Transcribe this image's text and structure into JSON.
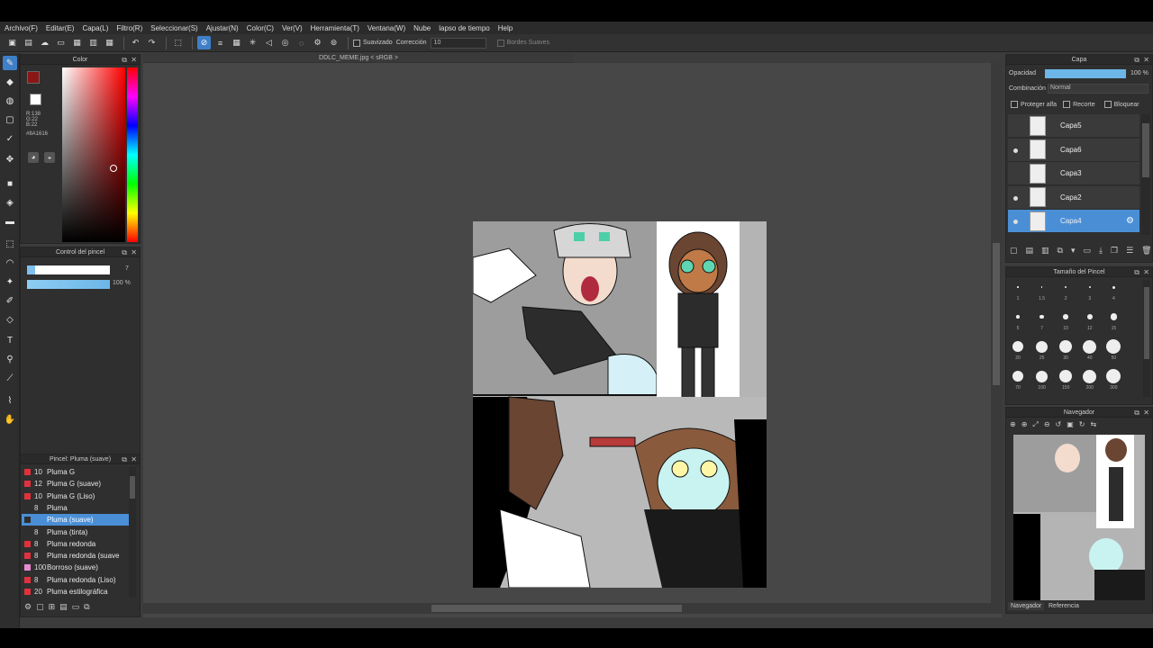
{
  "menu": [
    "Archivo(F)",
    "Editar(E)",
    "Capa(L)",
    "Filtro(R)",
    "Seleccionar(S)",
    "Ajustar(N)",
    "Color(C)",
    "Ver(V)",
    "Herramienta(T)",
    "Ventana(W)",
    "Nube",
    "lapso de tiempo",
    "Help"
  ],
  "toolbar": {
    "smooth_label": "Suavizado",
    "correction_label": "Corrección",
    "correction_value": "10",
    "soft_edges_label": "Bordes Suaves"
  },
  "color_panel": {
    "title": "Color",
    "current_color": "#8A1616",
    "r": "R:138",
    "g": "G:22",
    "b": "B:22",
    "hex": "#8A1616"
  },
  "brush_control": {
    "title": "Control del pincel",
    "size": "7",
    "opacity": "100 %"
  },
  "brush_panel": {
    "title": "Pincel: Pluma (suave)",
    "items": [
      {
        "num": "10",
        "name": "Pluma G",
        "color": "#e0323c"
      },
      {
        "num": "12",
        "name": "Pluma G (suave)",
        "color": "#e0323c"
      },
      {
        "num": "10",
        "name": "Pluma G (Liso)",
        "color": "#e0323c"
      },
      {
        "num": "8",
        "name": "Pluma",
        "color": "#2e2e2e"
      },
      {
        "num": "",
        "name": "Pluma (suave)",
        "color": "#2e2e2e",
        "selected": true
      },
      {
        "num": "8",
        "name": "Pluma (tinta)",
        "color": "#2e2e2e"
      },
      {
        "num": "8",
        "name": "Pluma redonda",
        "color": "#e0323c"
      },
      {
        "num": "8",
        "name": "Pluma redonda (suave",
        "color": "#e0323c"
      },
      {
        "num": "100",
        "name": "Borroso (suave)",
        "color": "#e98ad2"
      },
      {
        "num": "8",
        "name": "Pluma redonda (Liso)",
        "color": "#e0323c"
      },
      {
        "num": "20",
        "name": "Pluma estilográfica",
        "color": "#e0323c"
      }
    ]
  },
  "document": {
    "tab": "DDLC_MEME.jpg < sRGB >"
  },
  "layer_panel": {
    "title": "Capa",
    "opacity_label": "Opacidad",
    "opacity_value": "100 %",
    "opacity_fraction": 1.0,
    "blend_label": "Combinación",
    "blend_value": "Normal",
    "protect_alpha": "Proteger alfa",
    "clip": "Recorte",
    "lock": "Bloquear",
    "layers": [
      {
        "name": "Capa5",
        "visible": false,
        "selected": false
      },
      {
        "name": "Capa6",
        "visible": true,
        "selected": false
      },
      {
        "name": "Capa3",
        "visible": false,
        "selected": false
      },
      {
        "name": "Capa2",
        "visible": true,
        "selected": false
      },
      {
        "name": "Capa4",
        "visible": true,
        "selected": true
      }
    ]
  },
  "brush_size_panel": {
    "title": "Tamaño del Pincel",
    "sizes": [
      "1",
      "1.5",
      "2",
      "3",
      "4",
      "5",
      "7",
      "10",
      "12",
      "15",
      "20",
      "25",
      "30",
      "40",
      "50",
      "70",
      "100",
      "150",
      "200",
      "300"
    ]
  },
  "navigator_panel": {
    "title": "Navegador",
    "tab_navigator": "Navegador",
    "tab_reference": "Referencia"
  }
}
